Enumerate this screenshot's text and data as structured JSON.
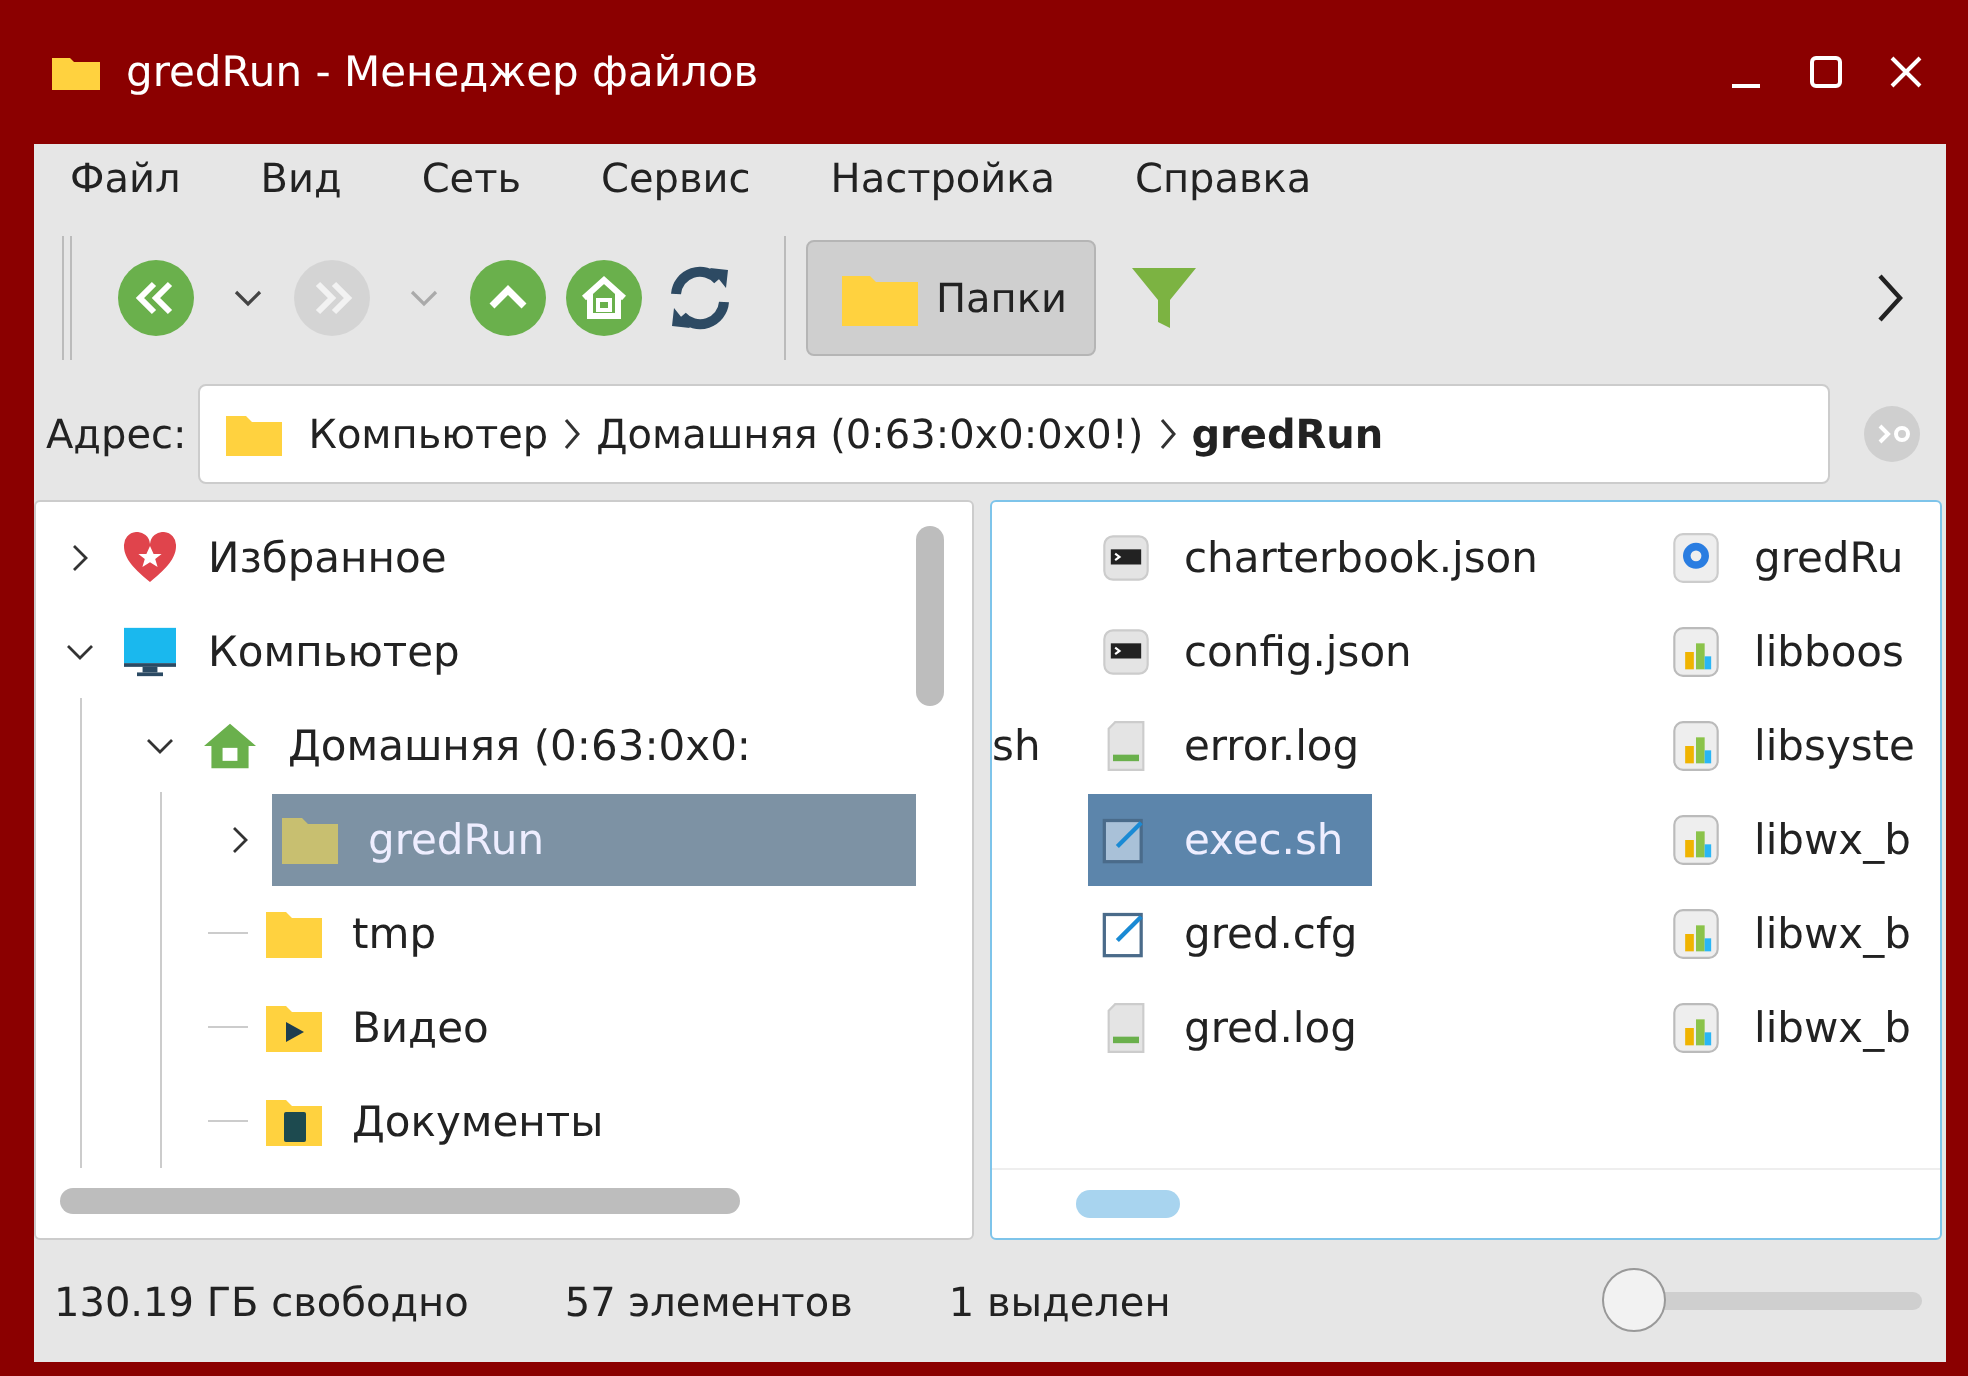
{
  "window": {
    "title": "gredRun - Менеджер файлов"
  },
  "menu": [
    "Файл",
    "Вид",
    "Сеть",
    "Сервис",
    "Настройка",
    "Справка"
  ],
  "toolbar": [
    {
      "kind": "back",
      "disabled": false
    },
    {
      "kind": "caret",
      "disabled": false
    },
    {
      "kind": "forward",
      "disabled": true
    },
    {
      "kind": "caret",
      "disabled": true
    },
    {
      "kind": "up",
      "disabled": false
    },
    {
      "kind": "home",
      "disabled": false
    },
    {
      "kind": "refresh",
      "disabled": false
    },
    {
      "kind": "folders",
      "label": "Папки",
      "selected": true,
      "disabled": false
    },
    {
      "kind": "filter",
      "disabled": false
    }
  ],
  "address": {
    "label": "Адрес:",
    "crumbs": [
      "Компьютер",
      "Домашняя (0:63:0x0:0x0!)",
      "gredRun"
    ],
    "go_disabled": true
  },
  "tree": {
    "items": [
      {
        "label": "Избранное",
        "kind": "heart",
        "expanded": false,
        "selected": false
      },
      {
        "label": "Компьютер",
        "kind": "monitor",
        "expanded": true,
        "selected": false,
        "children": [
          {
            "label": "Домашняя (0:63:0x0:",
            "kind": "home",
            "expanded": true,
            "selected": false,
            "children": [
              {
                "label": "gredRun",
                "kind": "folder",
                "expanded": false,
                "selected": true
              },
              {
                "label": "tmp",
                "kind": "folder",
                "selected": false
              },
              {
                "label": "Видео",
                "kind": "video",
                "selected": false
              },
              {
                "label": "Документы",
                "kind": "docs",
                "selected": false
              }
            ]
          }
        ]
      }
    ]
  },
  "files": [
    {
      "main": {
        "name": "charterbook.json",
        "kind": "terminal",
        "selected": false
      },
      "side": {
        "name": "gredRu",
        "kind": "gear",
        "selected": false
      }
    },
    {
      "main": {
        "name": "config.json",
        "kind": "terminal",
        "selected": false
      },
      "side": {
        "name": "libboos",
        "kind": "library",
        "selected": false
      }
    },
    {
      "cut_name": "sh",
      "main": {
        "name": "error.log",
        "kind": "log",
        "selected": false
      },
      "side": {
        "name": "libsyste",
        "kind": "library",
        "selected": false
      }
    },
    {
      "main": {
        "name": "exec.sh",
        "kind": "edit",
        "selected": true
      },
      "side": {
        "name": "libwx_b",
        "kind": "library",
        "selected": false
      }
    },
    {
      "main": {
        "name": "gred.cfg",
        "kind": "edit",
        "selected": false
      },
      "side": {
        "name": "libwx_b",
        "kind": "library",
        "selected": false
      }
    },
    {
      "main": {
        "name": "gred.log",
        "kind": "log",
        "selected": false
      },
      "side": {
        "name": "libwx_b",
        "kind": "library",
        "selected": false
      }
    }
  ],
  "status": {
    "free": "130.19 ГБ свободно",
    "count": "57 элементов",
    "selection": "1 выделен",
    "zoom": {
      "level": 0
    }
  }
}
